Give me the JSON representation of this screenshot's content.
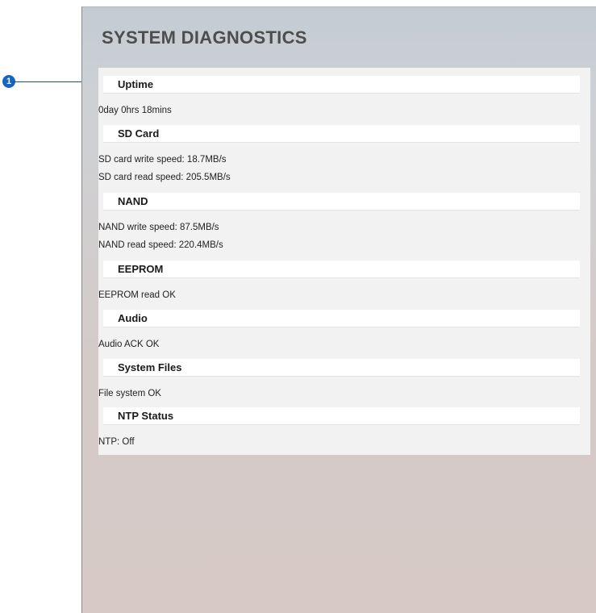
{
  "page_title": "SYSTEM DIAGNOSTICS",
  "callout": {
    "number": "1"
  },
  "sections": [
    {
      "heading": "Uptime",
      "lines": [
        "0day 0hrs 18mins"
      ]
    },
    {
      "heading": "SD Card",
      "lines": [
        "SD card write speed: 18.7MB/s",
        "SD card read speed: 205.5MB/s"
      ]
    },
    {
      "heading": "NAND",
      "lines": [
        "NAND write speed: 87.5MB/s",
        "NAND read speed: 220.4MB/s"
      ]
    },
    {
      "heading": "EEPROM",
      "lines": [
        "EEPROM read OK"
      ]
    },
    {
      "heading": "Audio",
      "lines": [
        "Audio ACK OK"
      ]
    },
    {
      "heading": "System Files",
      "lines": [
        "File system OK"
      ]
    },
    {
      "heading": "NTP Status",
      "lines": [
        "NTP: Off"
      ]
    }
  ],
  "colors": {
    "callout": "#1565c0",
    "title": "#4d4d4d"
  }
}
